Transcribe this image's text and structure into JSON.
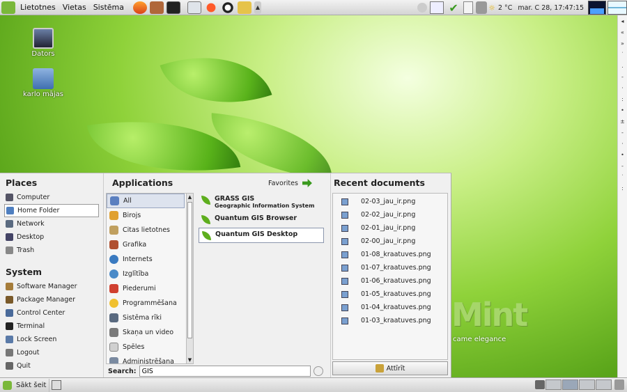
{
  "topbar": {
    "menus": [
      "Lietotnes",
      "Vietas",
      "Sistēma"
    ],
    "launcher_icons": [
      "mint-menu-icon",
      "firefox-icon",
      "tools-icon",
      "terminal-icon",
      "screenshot-icon",
      "record-icon",
      "eye-icon",
      "folder-icon",
      "dropdown-icon"
    ],
    "temperature": "2 °C",
    "clock": "mar. C  28, 17:47:15"
  },
  "desktop": {
    "icons": [
      {
        "label": "Dators"
      },
      {
        "label": "karlo mājas"
      }
    ]
  },
  "menu": {
    "places": {
      "title": "Places",
      "items": [
        "Computer",
        "Home Folder",
        "Network",
        "Desktop",
        "Trash"
      ],
      "selected": "Home Folder"
    },
    "system": {
      "title": "System",
      "items": [
        "Software Manager",
        "Package Manager",
        "Control Center",
        "Terminal",
        "Lock Screen",
        "Logout",
        "Quit"
      ]
    },
    "applications": {
      "title": "Applications",
      "favorites_label": "Favorites",
      "categories": [
        "All",
        "Birojs",
        "Citas lietotnes",
        "Grafika",
        "Internets",
        "Izglītība",
        "Piederumi",
        "Programmēšana",
        "Sistēma rīki",
        "Skaņa un video",
        "Spēles",
        "Administrēšana"
      ],
      "selected_category": "All",
      "results": [
        {
          "name": "GRASS GIS",
          "desc": "Geographic Information System"
        },
        {
          "name": "Quantum GIS Browser",
          "desc": ""
        },
        {
          "name": "Quantum GIS Desktop",
          "desc": ""
        }
      ],
      "search_label": "Search:",
      "search_value": "GIS"
    },
    "recent": {
      "title": "Recent documents",
      "items": [
        "02-03_jau_ir.png",
        "02-02_jau_ir.png",
        "02-01_jau_ir.png",
        "02-00_jau_ir.png",
        "01-08_kraatuves.png",
        "01-07_kraatuves.png",
        "01-06_kraatuves.png",
        "01-05_kraatuves.png",
        "01-04_kraatuves.png",
        "01-03_kraatuves.png"
      ],
      "clear_label": "Attīrīt"
    }
  },
  "branding": {
    "logo_text": "Mint",
    "tagline": "came elegance"
  },
  "bottombar": {
    "start_label": "Sākt šeit",
    "workspaces": 4,
    "active_workspace": 2
  },
  "colors": {
    "accent": "#5eae1e",
    "selection": "#dde3ee"
  }
}
